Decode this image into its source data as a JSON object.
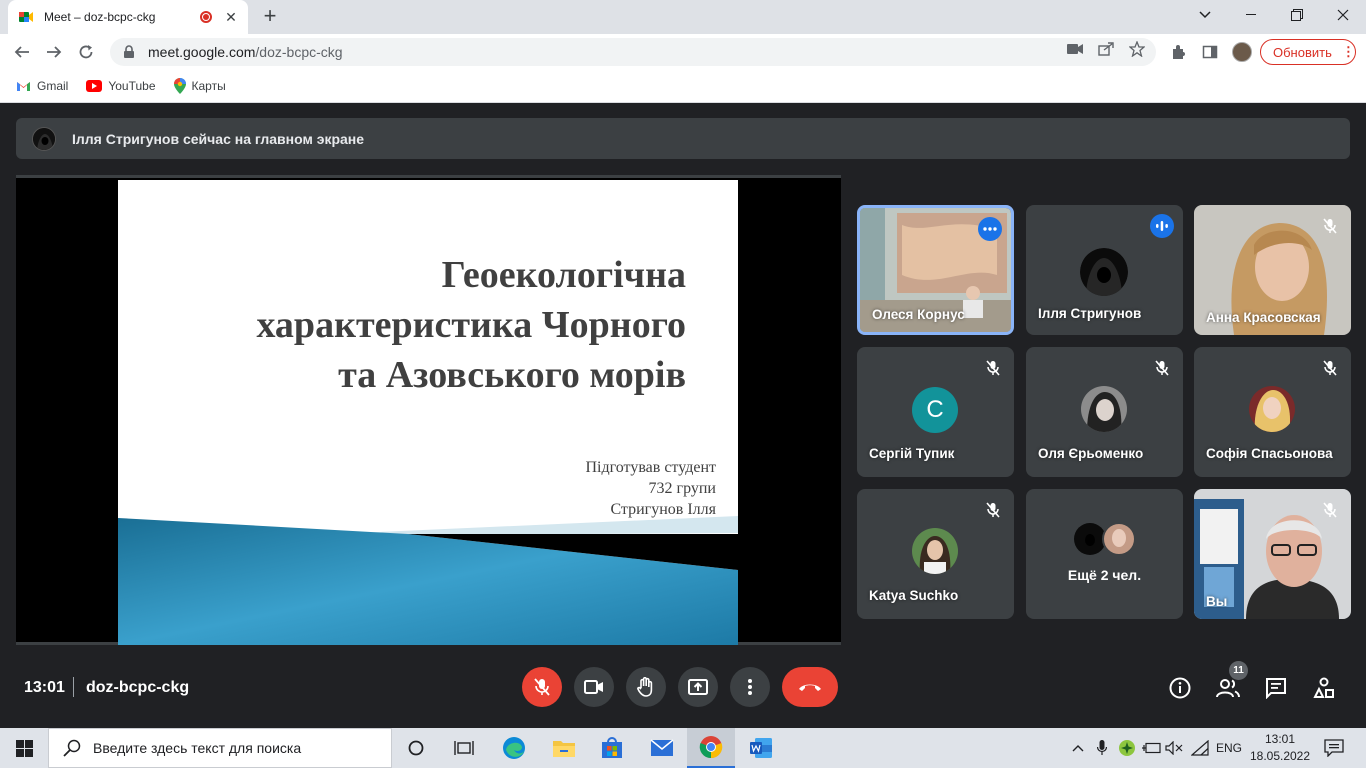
{
  "browser": {
    "tab_title": "Meet – doz-bcpc-ckg",
    "url_host": "meet.google.com",
    "url_path": "/doz-bcpc-ckg",
    "update_label": "Обновить",
    "bookmarks": [
      {
        "label": "Gmail",
        "icon": "gmail-icon"
      },
      {
        "label": "YouTube",
        "icon": "youtube-icon"
      },
      {
        "label": "Карты",
        "icon": "maps-icon"
      }
    ]
  },
  "meet": {
    "banner_text": "Ілля Стригунов сейчас на главном экране",
    "slide": {
      "title_lines": [
        "Геоекологічна",
        "характеристика Чорного",
        "та Азовського морів"
      ],
      "author_lines": [
        "Підготував студент",
        "732 групи",
        "Стригунов Ілля"
      ]
    },
    "participants": [
      {
        "name": "Олеся Корнус",
        "status": "more-options"
      },
      {
        "name": "Ілля Стригунов",
        "status": "speaking"
      },
      {
        "name": "Анна Красовская",
        "status": "muted"
      },
      {
        "name": "Сергій Тупик",
        "status": "muted",
        "initial": "С"
      },
      {
        "name": "Оля Єрьоменко",
        "status": "muted"
      },
      {
        "name": "Софія Спасьонова",
        "status": "muted"
      },
      {
        "name": "Katya Suchko",
        "status": "muted"
      },
      {
        "name": "Вы",
        "status": "muted"
      }
    ],
    "more_label": "Ещё 2 чел.",
    "time": "13:01",
    "meeting_code": "doz-bcpc-ckg",
    "participant_count": "11"
  },
  "taskbar": {
    "search_placeholder": "Введите здесь текст для поиска",
    "lang": "ENG",
    "time": "13:01",
    "date": "18.05.2022"
  },
  "colors": {
    "meet_bg": "#202124",
    "tile_bg": "#3c4043",
    "danger": "#ea4335",
    "accent": "#1a73e8"
  }
}
